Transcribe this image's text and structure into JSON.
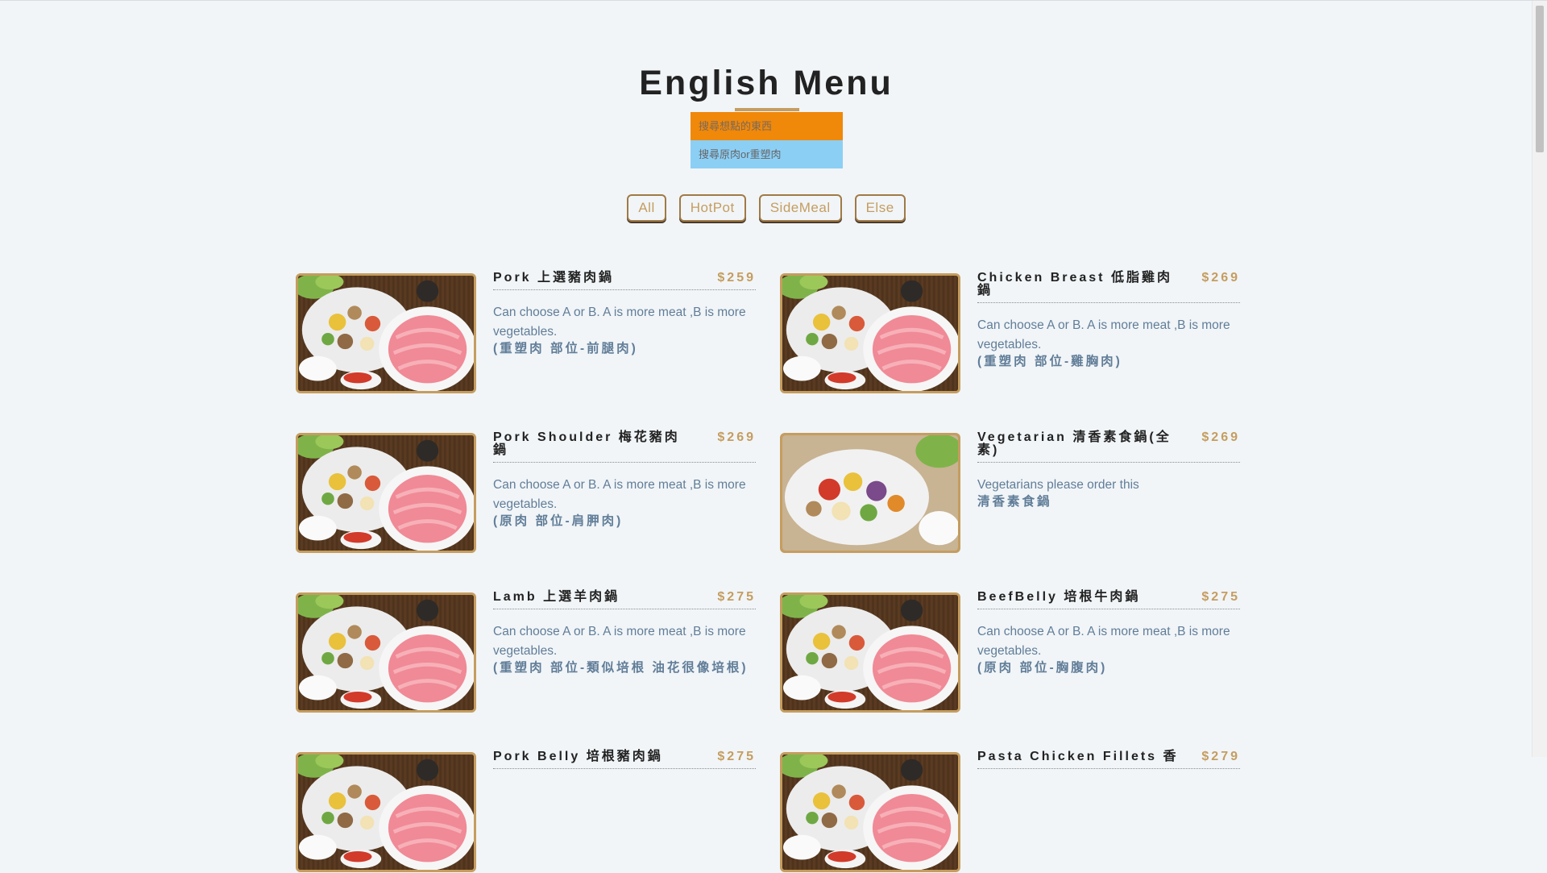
{
  "header": {
    "title": "English Menu",
    "search_placeholder": "搜尋想點的東西",
    "meat_search_placeholder": "搜尋原肉or重塑肉"
  },
  "filters": [
    "All",
    "HotPot",
    "SideMeal",
    "Else"
  ],
  "menu": [
    {
      "name": "Pork 上選豬肉鍋",
      "price": "$259",
      "desc": "Can choose A or B. A is more meat ,B is more vegetables.",
      "note": "(重塑肉 部位-前腿肉)"
    },
    {
      "name": "Chicken Breast 低脂雞肉鍋",
      "price": "$269",
      "desc": "Can choose A or B. A is more meat ,B is more vegetables.",
      "note": "(重塑肉 部位-雞胸肉)"
    },
    {
      "name": "Pork Shoulder 梅花豬肉鍋",
      "price": "$269",
      "desc": "Can choose A or B. A is more meat ,B is more vegetables.",
      "note": "(原肉 部位-肩胛肉)"
    },
    {
      "name": "Vegetarian 清香素食鍋(全素)",
      "price": "$269",
      "desc": "Vegetarians please order this",
      "note": "清香素食鍋"
    },
    {
      "name": "Lamb 上選羊肉鍋",
      "price": "$275",
      "desc": "Can choose A or B. A is more meat ,B is more vegetables.",
      "note": "(重塑肉 部位-類似培根 油花很像培根)"
    },
    {
      "name": "BeefBelly 培根牛肉鍋",
      "price": "$275",
      "desc": "Can choose A or B. A is more meat ,B is more vegetables.",
      "note": "(原肉 部位-胸腹肉)"
    },
    {
      "name": "Pork Belly 培根豬肉鍋",
      "price": "$275",
      "desc": "",
      "note": ""
    },
    {
      "name": "Pasta Chicken Fillets 香",
      "price": "$279",
      "desc": "",
      "note": ""
    }
  ],
  "colors": {
    "accent": "#c59d5f",
    "search_orange": "#f0880a",
    "search_blue": "#8ccff5",
    "text_muted": "#617d98"
  }
}
